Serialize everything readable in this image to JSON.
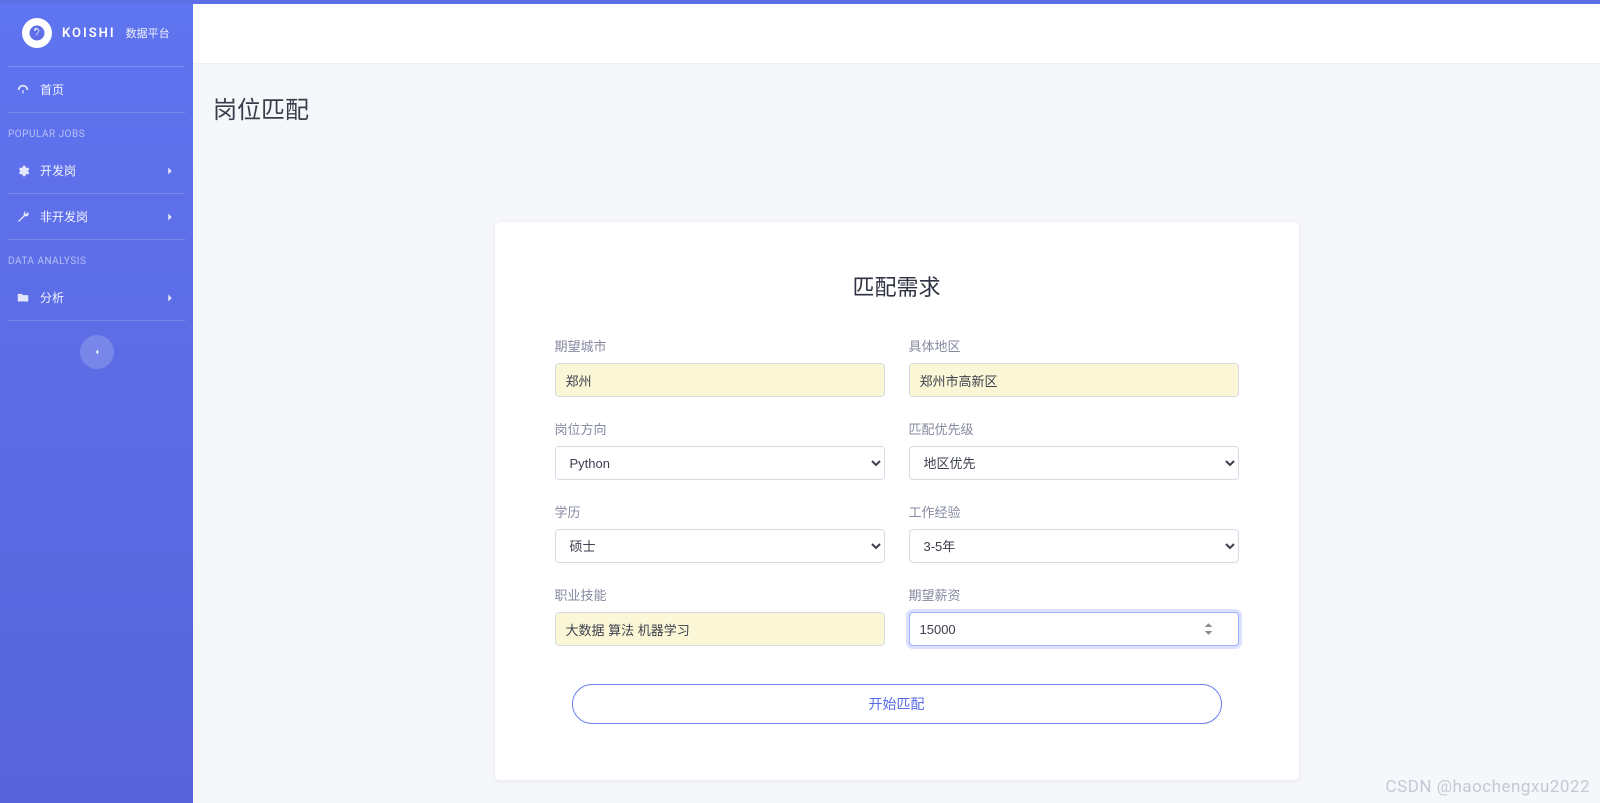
{
  "brand": {
    "name": "KOISHI",
    "subtitle": "数据平台"
  },
  "sidebar": {
    "home_label": "首页",
    "section1_header": "POPULAR JOBS",
    "items1": [
      {
        "label": "开发岗"
      },
      {
        "label": "非开发岗"
      }
    ],
    "section2_header": "DATA ANALYSIS",
    "items2": [
      {
        "label": "分析"
      }
    ]
  },
  "page": {
    "title": "岗位匹配"
  },
  "card": {
    "title": "匹配需求"
  },
  "form": {
    "city": {
      "label": "期望城市",
      "value": "郑州"
    },
    "area": {
      "label": "具体地区",
      "value": "郑州市高新区"
    },
    "direction": {
      "label": "岗位方向",
      "value": "Python",
      "options": [
        "Python"
      ]
    },
    "priority": {
      "label": "匹配优先级",
      "value": "地区优先",
      "options": [
        "地区优先"
      ]
    },
    "edu": {
      "label": "学历",
      "value": "硕士",
      "options": [
        "硕士"
      ]
    },
    "exp": {
      "label": "工作经验",
      "value": "3-5年",
      "options": [
        "3-5年"
      ]
    },
    "skills": {
      "label": "职业技能",
      "value": "大数据 算法 机器学习"
    },
    "salary": {
      "label": "期望薪资",
      "value": "15000"
    },
    "submit_label": "开始匹配"
  },
  "watermark": "CSDN @haochengxu2022"
}
